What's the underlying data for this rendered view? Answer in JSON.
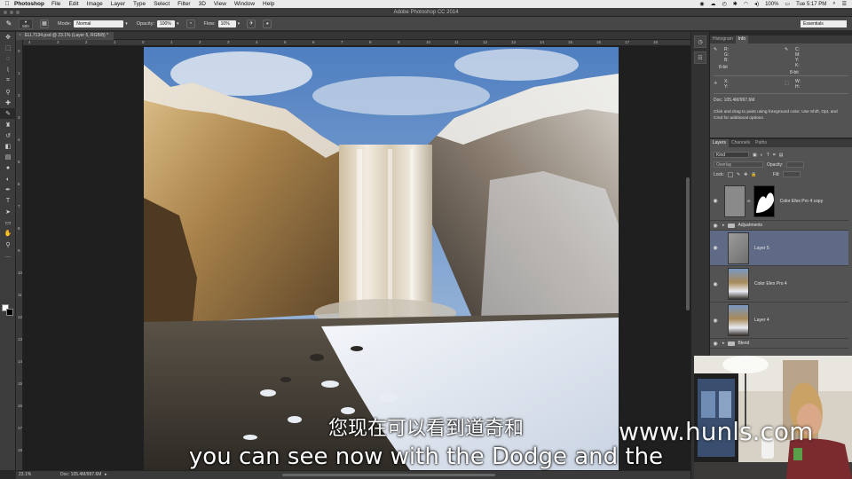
{
  "menubar": {
    "apple": "",
    "app_name": "Photoshop",
    "items": [
      "File",
      "Edit",
      "Image",
      "Layer",
      "Type",
      "Select",
      "Filter",
      "3D",
      "View",
      "Window",
      "Help"
    ],
    "battery": "100%",
    "clock": "Tue 5:17 PM"
  },
  "window": {
    "title": "Adobe Photoshop CC 2014"
  },
  "options_bar": {
    "brush_size": "500",
    "mode_label": "Mode:",
    "mode_value": "Normal",
    "opacity_label": "Opacity:",
    "opacity_value": "100%",
    "flow_label": "Flow:",
    "flow_value": "10%",
    "workspace": "Essentials"
  },
  "document": {
    "tab_title": "ELL7134.psd @ 23.1% (Layer 5, RGB/8) *",
    "close_glyph": "×",
    "zoom": "23.1%",
    "doc_size": "Doc: 105.4M/997.6M"
  },
  "ruler": {
    "top_ticks": [
      "4",
      "3",
      "2",
      "1",
      "0",
      "1",
      "2",
      "3",
      "4",
      "5",
      "6",
      "7",
      "8",
      "9",
      "10",
      "11",
      "12",
      "13",
      "14",
      "15",
      "16",
      "17",
      "18"
    ],
    "left_ticks": [
      "0",
      "1",
      "2",
      "3",
      "4",
      "5",
      "6",
      "7",
      "8",
      "9",
      "10",
      "11",
      "12",
      "13",
      "14",
      "15",
      "16",
      "17",
      "18"
    ]
  },
  "info_panel": {
    "tabs": [
      "Histogram",
      "Info"
    ],
    "active_tab": "Info",
    "rgb_labels": "R:\nG:\nB:",
    "cmyk_labels": "C:\nM:\nY:\nK:",
    "bit_left": "8-bit",
    "bit_right": "8-bit",
    "xy_labels": "X:\nY:",
    "wh_labels": "W:\nH:",
    "doc_size": "Doc: 105.4M/997.6M",
    "hint": "Click and drag to paint using foreground color.  Use Shift, Opt, and Cmd for additional options."
  },
  "layers_panel": {
    "tabs": [
      "Layers",
      "Channels",
      "Paths"
    ],
    "active_tab": "Layers",
    "kind_filter": "Kind",
    "blend_mode": "Overlay",
    "opacity_label": "Opacity:",
    "lock_label": "Lock:",
    "fill_label": "Fill:",
    "layers": [
      {
        "name": "Color Efex Pro 4 copy",
        "type": "masked"
      },
      {
        "name": "Adjustments",
        "type": "group"
      },
      {
        "name": "Layer 5",
        "type": "pixel",
        "selected": true
      },
      {
        "name": "Color Efex Pro 4",
        "type": "pixel"
      },
      {
        "name": "Layer 4",
        "type": "pixel"
      },
      {
        "name": "Blend",
        "type": "group"
      }
    ]
  },
  "subtitles": {
    "chinese": "您现在可以看到道奇和",
    "english": "you can see now with the Dodge and the"
  },
  "watermark": "www.hunls.com"
}
